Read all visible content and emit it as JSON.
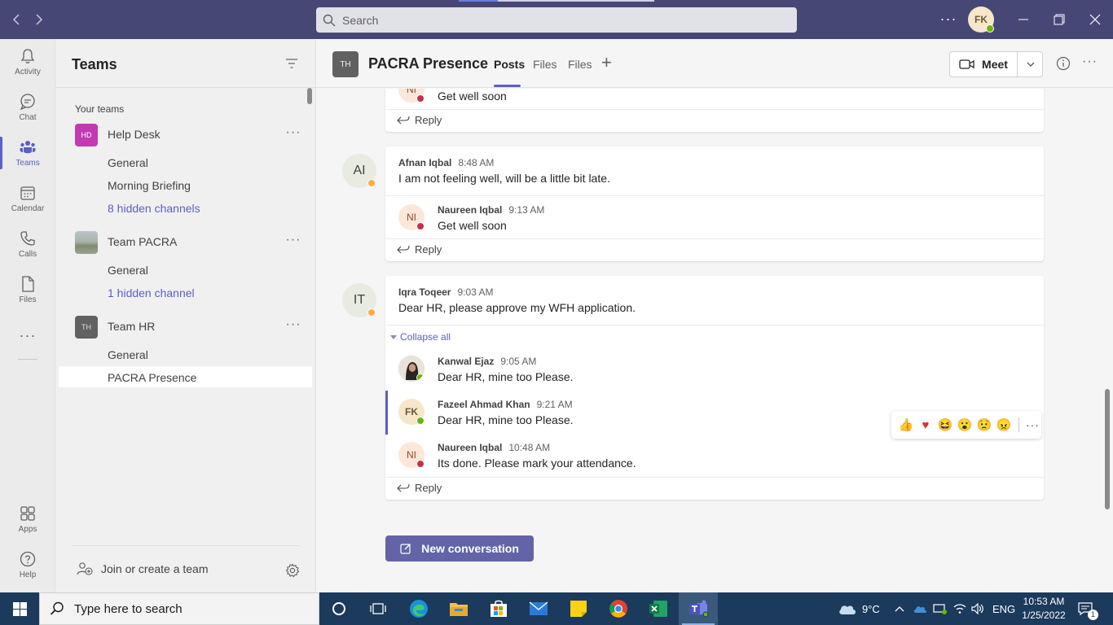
{
  "titlebar": {
    "search_placeholder": "Search",
    "user_initials": "FK"
  },
  "rail": {
    "items": [
      {
        "label": "Activity"
      },
      {
        "label": "Chat"
      },
      {
        "label": "Teams"
      },
      {
        "label": "Calendar"
      },
      {
        "label": "Calls"
      },
      {
        "label": "Files"
      },
      {
        "label": "Apps"
      },
      {
        "label": "Help"
      }
    ]
  },
  "teams_panel": {
    "title": "Teams",
    "section_label": "Your teams",
    "teams": [
      {
        "tile": "HD",
        "name": "Help Desk",
        "channels": [
          "General",
          "Morning Briefing"
        ],
        "hidden": "8 hidden channels",
        "tile_color": "#c239b3"
      },
      {
        "tile": "",
        "name": "Team PACRA",
        "channels": [
          "General"
        ],
        "hidden": "1 hidden channel"
      },
      {
        "tile": "TH",
        "name": "Team HR",
        "channels": [
          "General",
          "PACRA Presence"
        ],
        "tile_color": "#616161"
      }
    ],
    "join_label": "Join or create a team"
  },
  "channel": {
    "tile": "TH",
    "title": "PACRA Presence",
    "tabs": [
      "Posts",
      "Files",
      "Files"
    ],
    "active_tab": "Posts",
    "meet_label": "Meet"
  },
  "posts": [
    {
      "partial": true,
      "replies": [
        {
          "initials": "NI",
          "message": "Get well soon",
          "status": "busy"
        }
      ],
      "reply_label": "Reply"
    },
    {
      "initials": "AI",
      "author": "Afnan Iqbal",
      "time": "8:48 AM",
      "message": "I am not feeling well, will be a little bit late.",
      "status": "away",
      "replies": [
        {
          "initials": "NI",
          "author": "Naureen Iqbal",
          "time": "9:13 AM",
          "message": "Get well soon",
          "status": "busy"
        }
      ],
      "reply_label": "Reply"
    },
    {
      "initials": "IT",
      "author": "Iqra Toqeer",
      "time": "9:03 AM",
      "message": "Dear HR, please approve my WFH application.",
      "status": "away",
      "collapse_label": "Collapse all",
      "replies": [
        {
          "initials": "",
          "author": "Kanwal Ejaz",
          "time": "9:05 AM",
          "message": "Dear HR, mine too Please.",
          "status": "available"
        },
        {
          "initials": "FK",
          "author": "Fazeel Ahmad Khan",
          "time": "9:21 AM",
          "message": "Dear HR, mine too Please.",
          "status": "available"
        },
        {
          "initials": "NI",
          "author": "Naureen Iqbal",
          "time": "10:48 AM",
          "message": "Its done. Please mark your attendance.",
          "status": "busy"
        }
      ],
      "reply_label": "Reply"
    }
  ],
  "reactions": [
    "👍",
    "❤️",
    "😆",
    "😮",
    "😟",
    "😠"
  ],
  "new_conversation_label": "New conversation",
  "taskbar": {
    "search_placeholder": "Type here to search",
    "weather": "9°C",
    "language": "ENG",
    "time": "10:53 AM",
    "date": "1/25/2022",
    "notification_count": "1"
  },
  "colors": {
    "titlebar": "#464775",
    "accent": "#5b5fc7",
    "new_conversation_button": "#6264a7",
    "busy": "#c4314b",
    "available": "#6bb700",
    "away": "#ffaa44"
  }
}
